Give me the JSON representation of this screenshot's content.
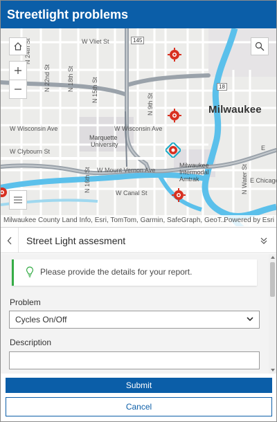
{
  "app": {
    "title": "Streetlight problems"
  },
  "map": {
    "city_label": "Milwaukee",
    "streets": {
      "w_vliet": "W Vliet St",
      "n_24th": "N 24th St",
      "n_22nd": "N 22nd St",
      "n_18th": "N 18th St",
      "n_15th": "N 15th St",
      "n_9th": "N 9th St",
      "w_wisconsin_left": "W Wisconsin Ave",
      "w_wisconsin_mid": "W Wisconsin Ave",
      "w_clybourn": "W Clybourn St",
      "w_mount_vernon": "W Mount Vernon Ave",
      "n_16th": "N 16th St",
      "w_canal": "W Canal St",
      "n_water": "N Water St",
      "e_chicago": "E Chicago S",
      "e_st": "E"
    },
    "pois": {
      "marquette_1": "Marquette",
      "marquette_2": "University",
      "amtrak_1": "Milwaukee",
      "amtrak_2": "Intermodal",
      "amtrak_3": "Amtrak"
    },
    "shields": {
      "hwy_145": "145",
      "hwy_18": "18"
    },
    "attribution": "Milwaukee County Land Info, Esri, TomTom, Garmin, SafeGraph, GeoT...",
    "powered_by": "Powered by Esri",
    "colors": {
      "marker": "#d83020",
      "marker_selected": "#17a9c6",
      "water": "#5bc0eb",
      "highway": "#9aa2aa"
    }
  },
  "panel": {
    "title": "Street Light assesment",
    "notice": "Please provide the details for your report.",
    "problem_label": "Problem",
    "problem_value": "Cycles On/Off",
    "description_label": "Description",
    "description_value": ""
  },
  "footer": {
    "submit": "Submit",
    "cancel": "Cancel"
  },
  "icons": [
    "home-icon",
    "zoom-in-icon",
    "zoom-out-icon",
    "search-icon",
    "layer-list-icon",
    "chevron-left-icon",
    "collapse-chevrons-icon",
    "lightbulb-icon",
    "chevron-down-icon"
  ]
}
